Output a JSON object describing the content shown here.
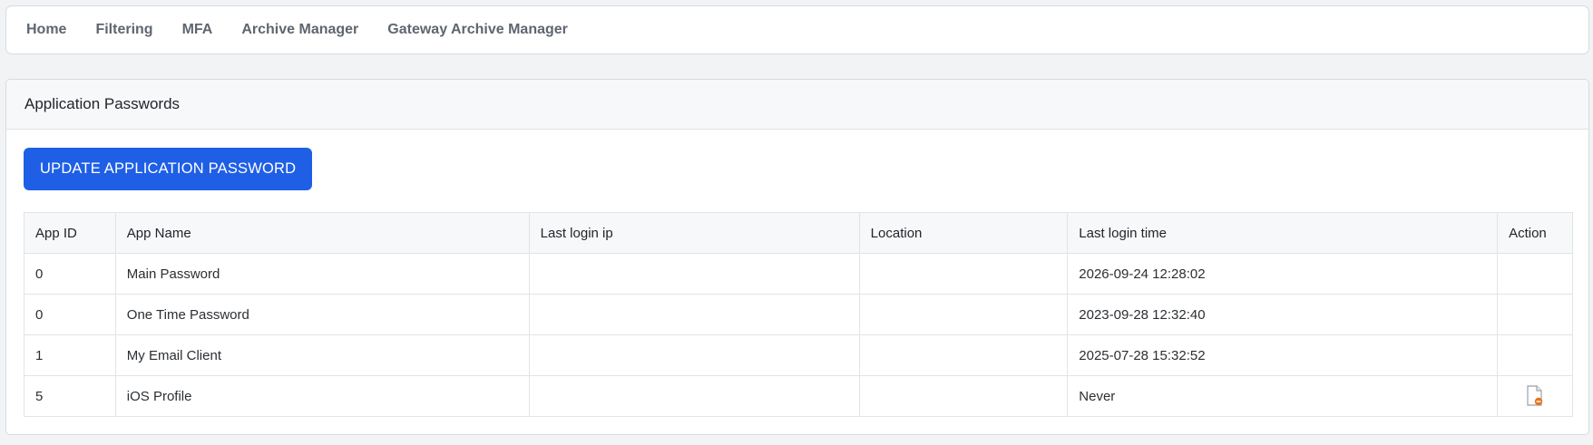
{
  "nav": {
    "items": [
      {
        "label": "Home"
      },
      {
        "label": "Filtering"
      },
      {
        "label": "MFA"
      },
      {
        "label": "Archive Manager"
      },
      {
        "label": "Gateway Archive Manager"
      }
    ]
  },
  "card": {
    "title": "Application Passwords",
    "update_button_label": "UPDATE APPLICATION PASSWORD"
  },
  "table": {
    "headers": [
      "App ID",
      "App Name",
      "Last login ip",
      "Location",
      "Last login time",
      "Action"
    ],
    "rows": [
      {
        "app_id": "0",
        "app_name": "Main Password",
        "last_login_ip": "",
        "location": "",
        "last_login_time": "2026-09-24 12:28:02",
        "action_icon": ""
      },
      {
        "app_id": "0",
        "app_name": "One Time Password",
        "last_login_ip": "",
        "location": "",
        "last_login_time": "2023-09-28 12:32:40",
        "action_icon": ""
      },
      {
        "app_id": "1",
        "app_name": "My Email Client",
        "last_login_ip": "",
        "location": "",
        "last_login_time": "2025-07-28 15:32:52",
        "action_icon": ""
      },
      {
        "app_id": "5",
        "app_name": "iOS Profile",
        "last_login_ip": "",
        "location": "",
        "last_login_time": "Never",
        "action_icon": "document-delete-icon"
      }
    ]
  },
  "colors": {
    "primary_button": "#1f5fe6",
    "icon_accent": "#e8741c"
  }
}
